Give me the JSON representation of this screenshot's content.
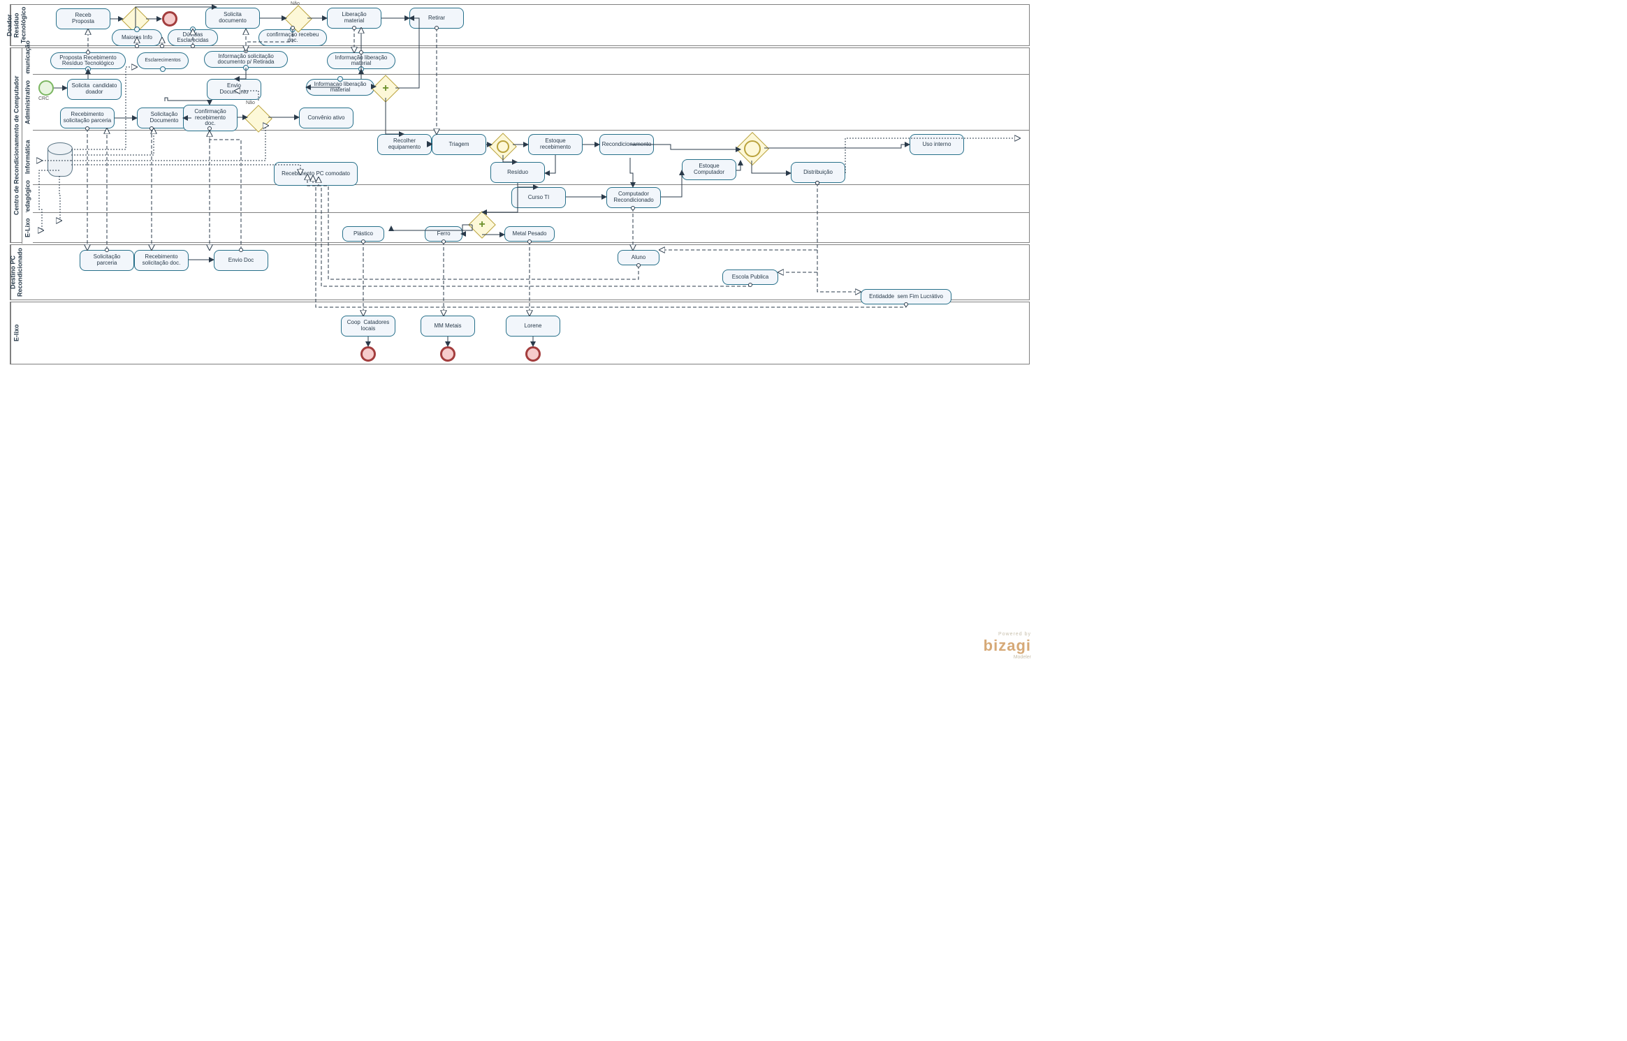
{
  "watermark": {
    "small": "Powered by",
    "brand": "bizagi",
    "sub": "Modeler"
  },
  "pools": {
    "p1": {
      "title": "Doador Resíduo\nTecnológico"
    },
    "p2": {
      "title": "Centro de Recondicionamento de Computador",
      "lanes": {
        "l1": "Comunicação",
        "l2": "Administrativo",
        "l3": "Informática",
        "l4": "Pedagógico",
        "l5": "E-Lixo"
      }
    },
    "p3": {
      "title": "Destino PC Recondicionado"
    },
    "p4": {
      "title": "E-lixo"
    }
  },
  "labels": {
    "nao_top": "Não",
    "nao_mid": "Não",
    "crc": "CRC"
  },
  "tasks": {
    "t_receb_prop": "Receb\nProposta",
    "t_maiores_info": "Maiores Info",
    "t_duvidas": "Dúvidas\nEsclarecidas",
    "t_solic_doc_top": "Solicita\ndocumento",
    "t_conf_receb_doc_top": "confirmação recebeu\ndoc.",
    "t_lib_material": "Liberação\nmaterial",
    "t_retirar": "Retirar",
    "t_proposta_receb": "Proposta Recebimento\nResíduo Tecnológico",
    "t_esclarecimentos": "Esclarecimentos",
    "t_info_solic_doc": "Informação solicitação\ndocumento p/ Retirada",
    "t_info_lib_mat": "Informação liberação\nmaterial",
    "t_solicita_cand": "Solicita  candidato\ndoador",
    "t_envio_doc": "Envio\nDocumento",
    "t_info_lib_mat2": "Informacao liberação\nmaterial",
    "t_receb_solic_parc": "Recebimento\nsolicitação parceria",
    "t_solic_docum": "Solicitação\nDocumento",
    "t_conf_receb_doc": "Confirmação\nrecebimento\ndoc.",
    "t_convenio": "Convênio ativo",
    "t_recolher": "Recolher\nequipamento",
    "t_triagem": "Triagem",
    "t_estoque_receb": "Estoque\nrecebimento",
    "t_recond": "Recondicionamento",
    "t_uso_interno": "Uso interno",
    "t_receb_pc_com": "Recebimento PC comodato",
    "t_residuo": "Resíduo",
    "t_estoque_comp": "Estoque\nComputador",
    "t_distrib": "Distribuição",
    "t_curso_ti": "Curso TI",
    "t_comp_recond": "Computador\nRecondicionado",
    "t_plastico": "Plástico",
    "t_ferro": "Ferro",
    "t_metal": "Metal Pesado",
    "t_sol_parceria": "Solicitação\nparceria",
    "t_receb_sol_doc": "Recebimento\nsolicitação doc.",
    "t_envio_doc2": "Envio Doc",
    "t_aluno": "Aluno",
    "t_escola": "Escola Publica",
    "t_entidade": "Entidadde  sem Fim Lucrátivo",
    "t_coop": "Coop  Catadores\nlocais",
    "t_mm": "MM Metais",
    "t_lorene": "Lorene"
  }
}
